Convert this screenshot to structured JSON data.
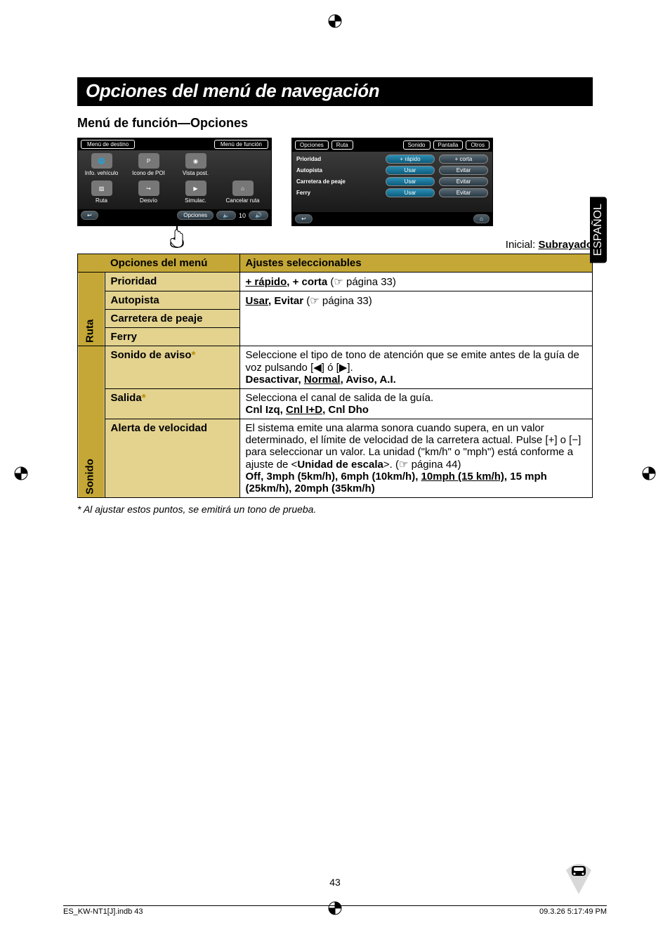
{
  "page": {
    "title": "Opciones del menú de navegación",
    "section_heading": "Menú de función—Opciones",
    "side_tab": "ESPAÑOL",
    "initial_prefix": "Inicial: ",
    "initial_value": "Subrayado",
    "page_number": "43",
    "footnote": "*  Al ajustar estos puntos, se emitirá un tono de prueba.",
    "footer_left": "ES_KW-NT1[J].indb   43",
    "footer_right": "09.3.26   5:17:49 PM"
  },
  "fig1": {
    "tab_left": "Menú de destino",
    "tab_right": "Menú de función",
    "items_row1": [
      "Info. vehículo",
      "Icono de POI",
      "Vista post."
    ],
    "items_row2": [
      "Ruta",
      "Desvío",
      "Simulac.",
      "Cancelar ruta"
    ],
    "back_label": "↩",
    "opciones_btn": "Opciones",
    "vol_value": "10"
  },
  "fig2": {
    "tab_opciones": "Opciones",
    "tab_ruta": "Ruta",
    "tab_sonido": "Sonido",
    "tab_pantalla": "Pantalla",
    "tab_otros": "Otros",
    "rows": [
      {
        "label": "Prioridad",
        "opt1": "+ rápido",
        "opt2": "+ corta",
        "active": 1
      },
      {
        "label": "Autopista",
        "opt1": "Usar",
        "opt2": "Evitar",
        "active": 1
      },
      {
        "label": "Carretera de peaje",
        "opt1": "Usar",
        "opt2": "Evitar",
        "active": 1
      },
      {
        "label": "Ferry",
        "opt1": "Usar",
        "opt2": "Evitar",
        "active": 1
      }
    ],
    "back_label": "↩"
  },
  "table": {
    "header_option": "Opciones del menú",
    "header_settings": "Ajustes seleccionables",
    "group_ruta": "Ruta",
    "group_sonido": "Sonido",
    "rows": {
      "prioridad": {
        "name": "Prioridad",
        "val_html": [
          "+ rápido",
          ", ",
          "+ corta",
          " (☞ página 33)"
        ]
      },
      "autopista": {
        "name": "Autopista",
        "val_html": [
          "Usar",
          ", ",
          "Evitar",
          " (☞ página 33)"
        ]
      },
      "peaje": {
        "name": "Carretera de peaje"
      },
      "ferry": {
        "name": "Ferry"
      },
      "sonido_aviso": {
        "name": "Sonido de aviso",
        "star": "*",
        "line1": "Seleccione el tipo de tono de atención que se emite antes de la guía de voz pulsando [◀] ó [▶].",
        "opts_prefix": "Desactivar, ",
        "opts_und": "Normal",
        "opts_suffix": ", Aviso, A.I."
      },
      "salida": {
        "name": "Salida",
        "star": "*",
        "line1": "Selecciona el canal de salida de la guía.",
        "opts_prefix": "Cnl Izq, ",
        "opts_und": "Cnl I+D",
        "opts_suffix": ", Cnl Dho"
      },
      "alerta": {
        "name": "Alerta de velocidad",
        "line1": "El sistema emite una alarma sonora cuando supera, en un valor determinado, el límite de velocidad de la carretera actual. Pulse [+] o [−] para seleccionar un valor. La unidad (\"km/h\" o \"mph\") está conforme a ajuste de <",
        "bold_inline": "Unidad de escala",
        "line1_suffix": ">. (☞ página 44)",
        "line2_prefix": "Off, 3mph (5km/h), 6mph (10km/h), ",
        "line2_und": "10mph (15 km/h)",
        "line2_suffix": ", 15 mph (25km/h), 20mph (35km/h)"
      }
    }
  }
}
